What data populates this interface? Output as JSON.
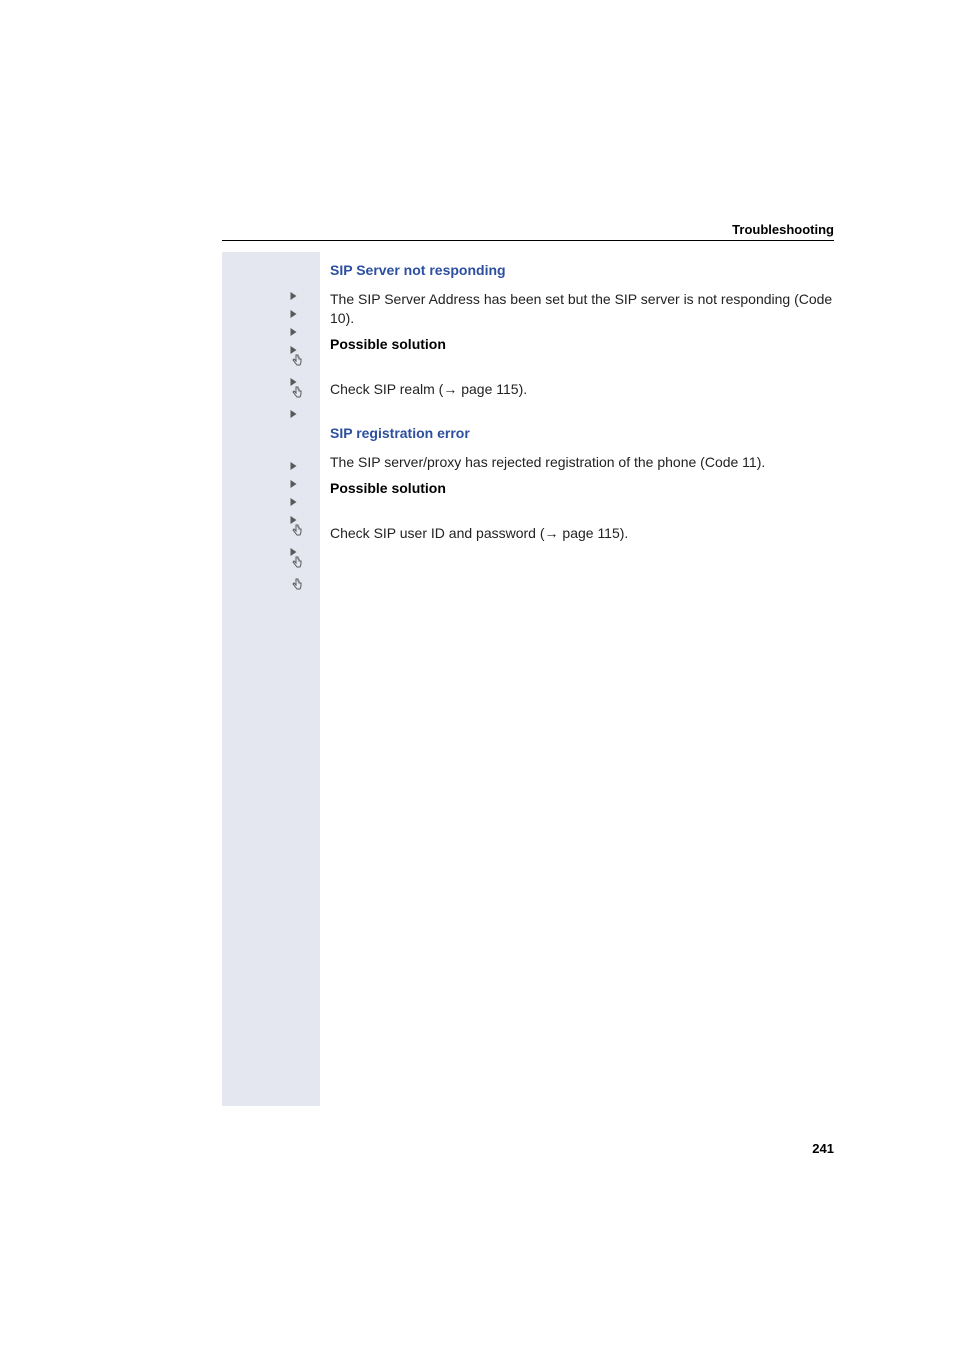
{
  "header": {
    "title": "Troubleshooting"
  },
  "sections": [
    {
      "heading": "SIP Server not responding",
      "description": "The SIP Server Address has been set but the SIP server is not responding (Code 10).",
      "solution_label": "Possible solution",
      "solution_text_prefix": "Check SIP realm (",
      "solution_page_ref": " page 115).",
      "arrow": "→"
    },
    {
      "heading": "SIP registration error",
      "description": "The SIP server/proxy has rejected registration of the phone (Code 11).",
      "solution_label": "Possible solution",
      "solution_text_prefix": "Check SIP user ID and password (",
      "solution_page_ref": " page 115).",
      "arrow": "→"
    }
  ],
  "page_number": "241"
}
